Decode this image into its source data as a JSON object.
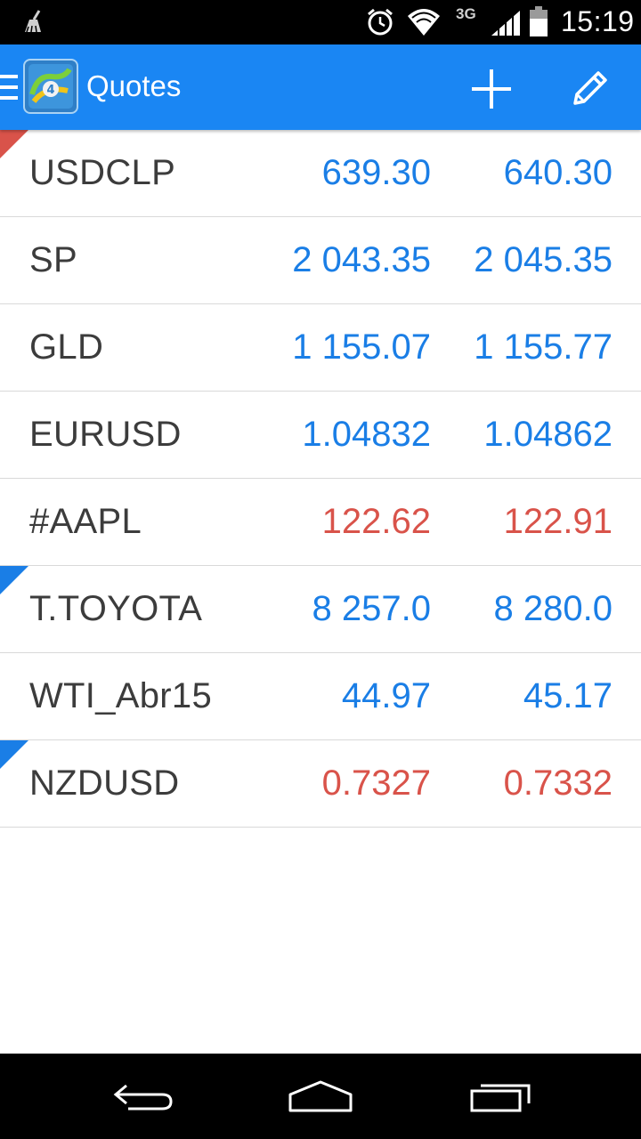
{
  "status_bar": {
    "time": "15:19",
    "network": "3G",
    "icons": [
      "notification-icon",
      "alarm-icon",
      "wifi-icon",
      "signal-icon",
      "battery-icon"
    ]
  },
  "app_bar": {
    "title": "Quotes",
    "actions": [
      "add-icon",
      "edit-icon"
    ]
  },
  "colors": {
    "up": "#1a7ee6",
    "down": "#d9534a",
    "app_bar": "#1a86f3"
  },
  "quotes": [
    {
      "symbol": "USDCLP",
      "bid": "639.30",
      "ask": "640.30",
      "direction": "up",
      "marker": "down"
    },
    {
      "symbol": "SP",
      "bid": "2 043.35",
      "ask": "2 045.35",
      "direction": "up",
      "marker": ""
    },
    {
      "symbol": "GLD",
      "bid": "1 155.07",
      "ask": "1 155.77",
      "direction": "up",
      "marker": ""
    },
    {
      "symbol": "EURUSD",
      "bid": "1.04832",
      "ask": "1.04862",
      "direction": "up",
      "marker": ""
    },
    {
      "symbol": "#AAPL",
      "bid": "122.62",
      "ask": "122.91",
      "direction": "down",
      "marker": ""
    },
    {
      "symbol": "T.TOYOTA",
      "bid": "8 257.0",
      "ask": "8 280.0",
      "direction": "up",
      "marker": "up"
    },
    {
      "symbol": "WTI_Abr15",
      "bid": "44.97",
      "ask": "45.17",
      "direction": "up",
      "marker": ""
    },
    {
      "symbol": "NZDUSD",
      "bid": "0.7327",
      "ask": "0.7332",
      "direction": "down",
      "marker": "up"
    }
  ],
  "nav_bar": [
    "back-icon",
    "home-icon",
    "recents-icon"
  ]
}
